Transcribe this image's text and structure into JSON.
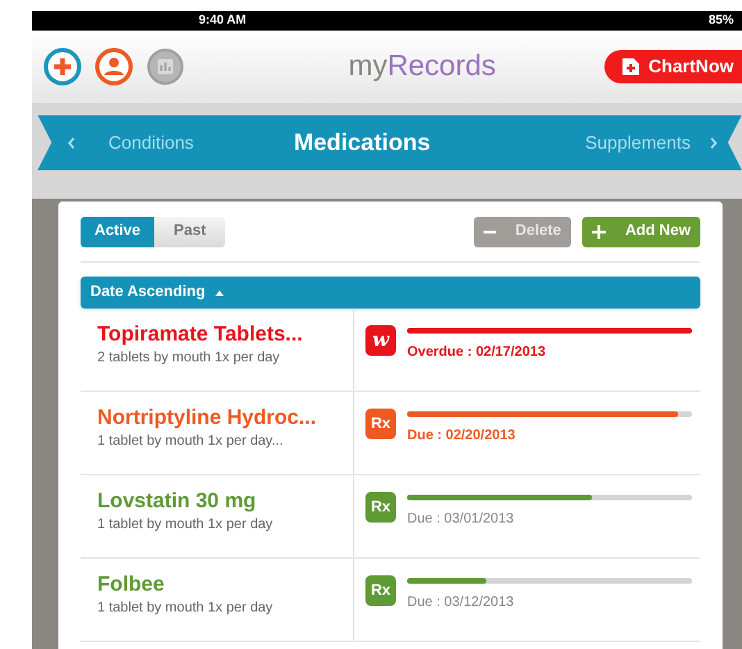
{
  "status_bar": {
    "time": "9:40 AM",
    "battery": "85%"
  },
  "header": {
    "title_prefix": "my",
    "title_main": "Records",
    "chartnow": "ChartNow"
  },
  "nav": {
    "prev": "Conditions",
    "current": "Medications",
    "next": "Supplements"
  },
  "filter_tabs": [
    {
      "label": "Active",
      "selected": true
    },
    {
      "label": "Past",
      "selected": false
    }
  ],
  "actions": {
    "delete": {
      "label": "Delete",
      "disabled": true
    },
    "add": "Add New"
  },
  "sort": {
    "label": "Date Ascending"
  },
  "medications": [
    {
      "name": "Topiramate Tablets...",
      "dose": "2 tablets by mouth 1x per day",
      "color": "#e8141b",
      "badge": "w",
      "kind": "store",
      "level": 1.0,
      "due": "Overdue : 02/17/2013",
      "urgent": true
    },
    {
      "name": "Nortriptyline Hydroc...",
      "dose": "1 tablet by mouth 1x per day...",
      "color": "#ee5a24",
      "badge": "Rx",
      "kind": "rx",
      "level": 0.95,
      "due": "Due : 02/20/2013",
      "urgent": true
    },
    {
      "name": "Lovstatin 30 mg",
      "dose": "1 tablet by mouth 1x per day",
      "color": "#5f9a35",
      "badge": "Rx",
      "kind": "rx",
      "level": 0.65,
      "due": "Due : 03/01/2013",
      "urgent": false
    },
    {
      "name": "Folbee",
      "dose": "1 tablet by mouth 1x per day",
      "color": "#5f9a35",
      "badge": "Rx",
      "kind": "rx",
      "level": 0.28,
      "due": "Due : 03/12/2013",
      "urgent": false
    }
  ]
}
